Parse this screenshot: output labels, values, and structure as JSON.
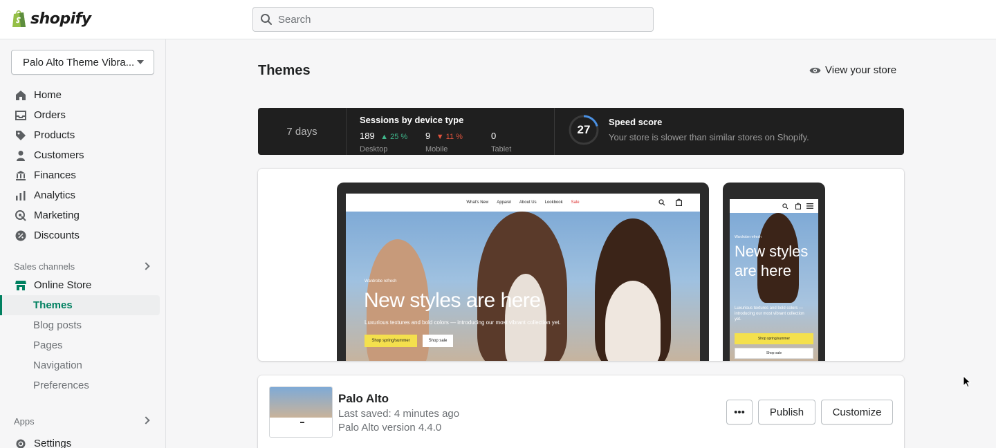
{
  "header": {
    "logo_text": "shopify",
    "search_placeholder": "Search"
  },
  "sidebar": {
    "store_name": "Palo Alto Theme Vibra...",
    "nav": [
      {
        "label": "Home",
        "icon": "home-icon"
      },
      {
        "label": "Orders",
        "icon": "inbox-icon"
      },
      {
        "label": "Products",
        "icon": "tag-icon"
      },
      {
        "label": "Customers",
        "icon": "person-icon"
      },
      {
        "label": "Finances",
        "icon": "bank-icon"
      },
      {
        "label": "Analytics",
        "icon": "bar-chart-icon"
      },
      {
        "label": "Marketing",
        "icon": "target-icon"
      },
      {
        "label": "Discounts",
        "icon": "discount-icon"
      }
    ],
    "sales_channels_label": "Sales channels",
    "online_store_label": "Online Store",
    "sub_items": [
      "Themes",
      "Blog posts",
      "Pages",
      "Navigation",
      "Preferences"
    ],
    "apps_label": "Apps",
    "settings_label": "Settings"
  },
  "main": {
    "title": "Themes",
    "view_store": "View your store",
    "stats": {
      "period": "7 days",
      "sessions_title": "Sessions by device type",
      "devices": [
        {
          "count": "189",
          "change": "25 %",
          "direction": "up",
          "label": "Desktop"
        },
        {
          "count": "9",
          "change": "11 %",
          "direction": "down",
          "label": "Mobile"
        },
        {
          "count": "0",
          "change": "",
          "direction": "",
          "label": "Tablet"
        }
      ],
      "speed_score": "27",
      "speed_title": "Speed score",
      "speed_desc": "Your store is slower than similar stores on Shopify."
    },
    "preview": {
      "nav_links": [
        "What's New",
        "Apparel",
        "About Us",
        "Lookbook",
        "Sale"
      ],
      "hero_small": "Wardrobe refresh",
      "hero_title": "New styles are here",
      "hero_sub": "Luxurious textures and bold colors — introducing our most vibrant collection yet.",
      "btn_primary": "Shop spring/summer",
      "btn_secondary": "Shop sale",
      "mobile_small": "Wardrobe refresh",
      "mobile_title": "New styles are here",
      "mobile_sub": "Luxurious textures and bold colors — introducing our most vibrant collection yet.",
      "mobile_btn_primary": "Shop spring/summer",
      "mobile_btn_secondary": "Shop sale"
    },
    "theme": {
      "name": "Palo Alto",
      "last_saved": "Last saved: 4 minutes ago",
      "version": "Palo Alto version 4.4.0",
      "more_label": "•••",
      "publish_label": "Publish",
      "customize_label": "Customize"
    }
  },
  "colors": {
    "brand_green": "#008060",
    "up": "#3fb68b",
    "down": "#e0533d",
    "speed_ring": "#4a90e2"
  }
}
